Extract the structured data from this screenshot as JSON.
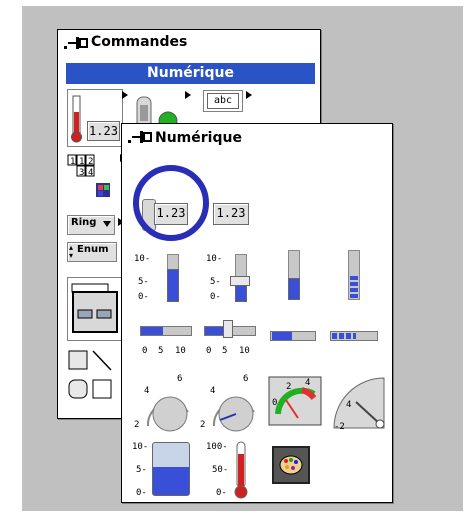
{
  "commandes_palette": {
    "title": "Commandes",
    "selected_category": "Numérique",
    "text_icon_label": "abc",
    "thermo_readout": "1.23",
    "array_cells": [
      "1",
      "1",
      "2",
      "3",
      "4"
    ],
    "ring_label": "Ring",
    "enum_label": "Enum"
  },
  "numerique_palette": {
    "title": "Numérique",
    "numeric_control_value": "1.23",
    "numeric_indicator_value": "1.23",
    "vslide_ticks": [
      "10-",
      "5-",
      "0-"
    ],
    "hslide_ticks": [
      "0",
      "5",
      "10"
    ],
    "knob_ticks": [
      "4",
      "6",
      "2"
    ],
    "meter_ticks": [
      "4",
      "2",
      "0"
    ],
    "gauge_ticks": [
      "4",
      "-2"
    ],
    "tank_ticks": [
      "10-",
      "5-",
      "0-"
    ],
    "thermo_ticks": [
      "100-",
      "50-",
      "0-"
    ]
  },
  "colors": {
    "highlight": "#2a53c5",
    "ring": "#2a2eb6",
    "fill_blue": "#3a4fd8",
    "thermo_red": "#d02020"
  }
}
